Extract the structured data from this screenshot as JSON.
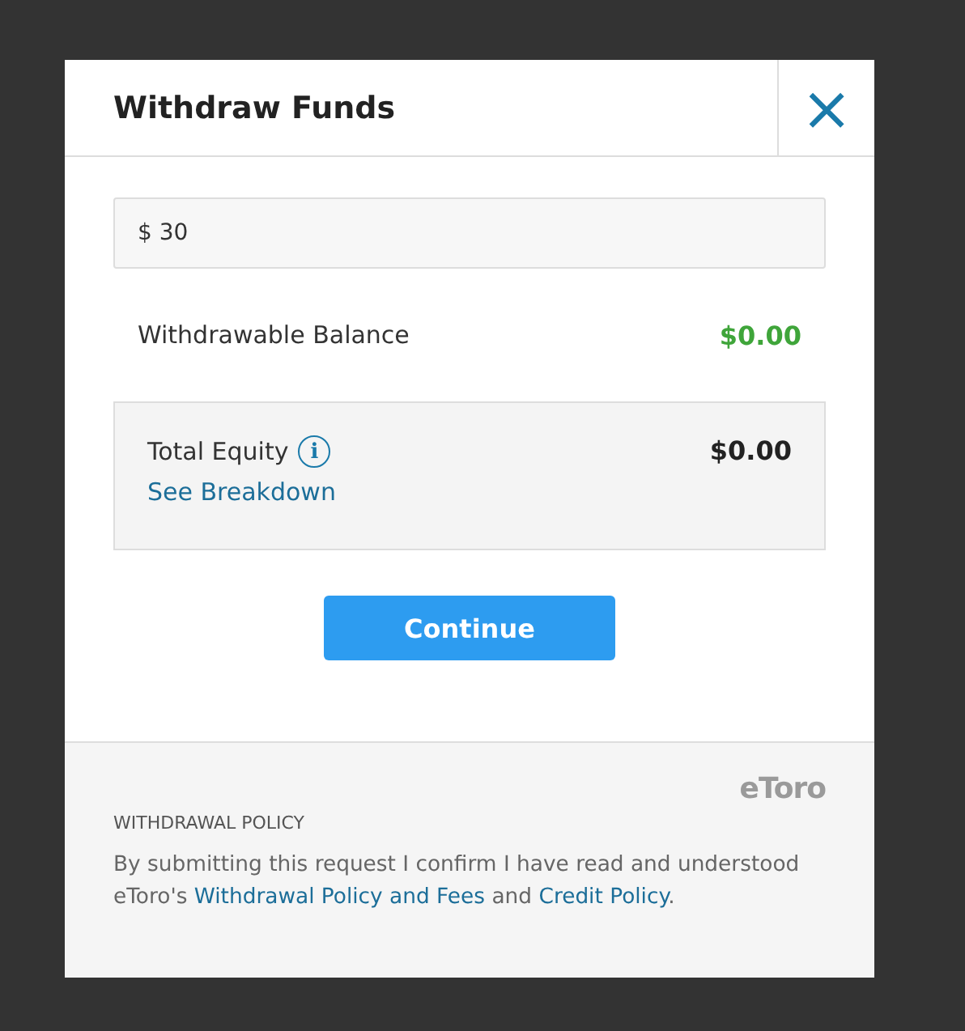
{
  "dialog": {
    "title": "Withdraw Funds",
    "close": "×"
  },
  "amount": {
    "value": "$ 30"
  },
  "withdrawable": {
    "label": "Withdrawable Balance",
    "value": "$0.00"
  },
  "equity": {
    "label": "Total Equity",
    "info": "i",
    "value": "$0.00",
    "link": "See Breakdown"
  },
  "button": "Continue",
  "footer": {
    "logo": "eToro",
    "heading": "WITHDRAWAL POLICY",
    "policy": [
      {
        "kind": "text",
        "text": "By submitting this request I confirm I have read and understood eToro's "
      },
      {
        "kind": "link",
        "text": "Withdrawal Policy and Fees"
      },
      {
        "kind": "text",
        "text": " and "
      },
      {
        "kind": "link",
        "text": "Credit Policy"
      },
      {
        "kind": "text",
        "text": "."
      }
    ]
  }
}
